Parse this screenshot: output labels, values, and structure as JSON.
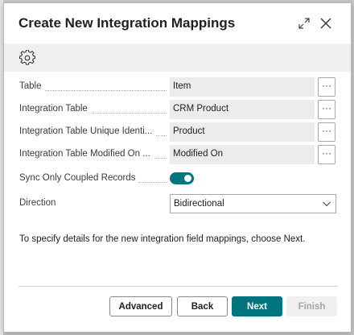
{
  "dialog": {
    "title": "Create New Integration Mappings"
  },
  "icons": {
    "expand": "expand-icon",
    "close": "close-icon",
    "settings": "gear-icon",
    "dropdown": "chevron-down-icon"
  },
  "fields": [
    {
      "label": "Table",
      "value": "Item",
      "assist": "···"
    },
    {
      "label": "Integration Table",
      "value": "CRM Product",
      "assist": "···"
    },
    {
      "label": "Integration Table Unique Identi...",
      "value": "Product",
      "assist": "···"
    },
    {
      "label": "Integration Table Modified On ...",
      "value": "Modified On",
      "assist": "···"
    }
  ],
  "sync_only_coupled": {
    "label": "Sync Only Coupled Records",
    "enabled": true
  },
  "direction": {
    "label": "Direction",
    "value": "Bidirectional"
  },
  "info_text": "To specify details for the new integration field mappings, choose Next.",
  "buttons": {
    "advanced": "Advanced",
    "back": "Back",
    "next": "Next",
    "finish": "Finish"
  },
  "colors": {
    "accent": "#00757f",
    "field_background": "#ececec",
    "disabled_text": "#a6a6a6"
  }
}
